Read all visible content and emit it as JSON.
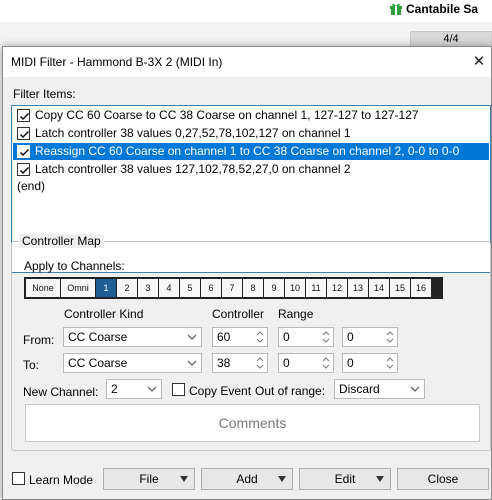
{
  "background_app": {
    "title": "Cantabile Sa",
    "counter": "4/4",
    "colors": {
      "gift_icon": "#2e9e3e"
    }
  },
  "dialog": {
    "title": "MIDI Filter - Hammond B-3X 2 (MIDI In)",
    "close_glyph": "✕",
    "filter_items_label": "Filter Items:",
    "filter_items": [
      {
        "text": "Copy CC 60 Coarse to CC 38 Coarse on channel 1, 127-127 to 127-127",
        "checked": true,
        "selected": false
      },
      {
        "text": "Latch controller 38 values 0,27,52,78,102,127 on channel 1",
        "checked": true,
        "selected": false
      },
      {
        "text": "Reassign CC 60 Coarse on channel 1 to CC 38 Coarse on channel 2, 0-0 to 0-0",
        "checked": true,
        "selected": true
      },
      {
        "text": "Latch controller 38 values 127,102,78,52,27,0 on channel 2",
        "checked": true,
        "selected": false
      }
    ],
    "end_item": "(end)",
    "controller_map": {
      "label": "Controller Map",
      "apply_label": "Apply to Channels:",
      "channels": [
        "None",
        "Omni",
        "1",
        "2",
        "3",
        "4",
        "5",
        "6",
        "7",
        "8",
        "9",
        "10",
        "11",
        "12",
        "13",
        "14",
        "15",
        "16"
      ],
      "selected_channel": "1",
      "col_kind": "Controller Kind",
      "col_controller": "Controller",
      "col_range": "Range",
      "from_label": "From:",
      "to_label": "To:",
      "from": {
        "kind": "CC Coarse",
        "controller": "60",
        "range_low": "0",
        "range_high": "0"
      },
      "to": {
        "kind": "CC Coarse",
        "controller": "38",
        "range_low": "0",
        "range_high": "0"
      },
      "new_channel_label": "New Channel:",
      "new_channel": "2",
      "copy_event_label": "Copy Event",
      "copy_event_checked": false,
      "out_of_range_label": "Out of range:",
      "out_of_range": "Discard",
      "comments": "Comments"
    },
    "bottom": {
      "learn_mode_label": "Learn Mode",
      "learn_mode_checked": false,
      "file_label": "File",
      "add_label": "Add",
      "edit_label": "Edit",
      "close_label": "Close"
    },
    "colors": {
      "selection": "#0078d7",
      "channel_selected": "#1e5d96",
      "list_border": "#3c7fb1"
    }
  }
}
